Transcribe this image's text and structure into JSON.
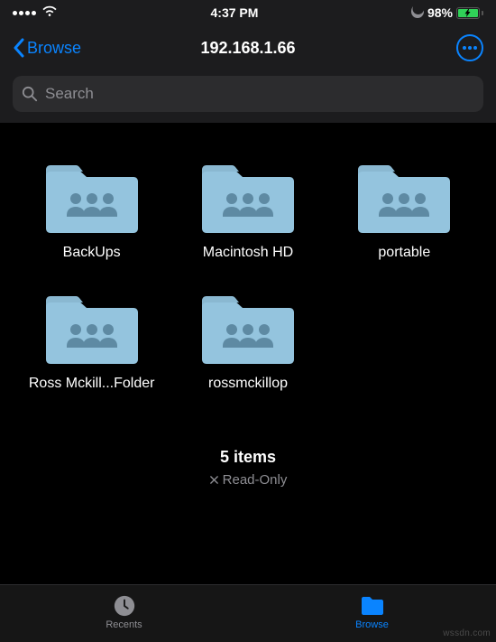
{
  "status": {
    "time": "4:37 PM",
    "battery_pct": "98%"
  },
  "nav": {
    "back_label": "Browse",
    "title": "192.168.1.66"
  },
  "search": {
    "placeholder": "Search"
  },
  "folders": [
    {
      "name": "BackUps"
    },
    {
      "name": "Macintosh HD"
    },
    {
      "name": "portable"
    },
    {
      "name": "Ross Mckill...Folder"
    },
    {
      "name": "rossmckillop"
    }
  ],
  "summary": {
    "count_label": "5 items",
    "readonly_label": "Read-Only"
  },
  "tabs": {
    "recents": "Recents",
    "browse": "Browse"
  },
  "watermark": "wssdn.com"
}
